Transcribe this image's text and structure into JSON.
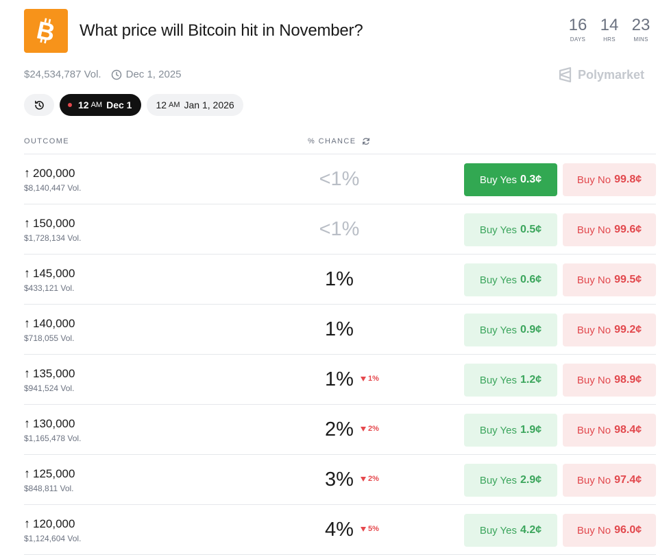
{
  "market": {
    "title": "What price will Bitcoin hit in November?",
    "volume": "$24,534,787 Vol.",
    "end_date": "Dec 1, 2025",
    "brand": "Polymarket",
    "logo_icon": "bitcoin-icon",
    "logo_color": "#f7931a"
  },
  "countdown": {
    "days": "16",
    "days_label": "DAYS",
    "hrs": "14",
    "hrs_label": "HRS",
    "mins": "23",
    "mins_label": "MINS"
  },
  "filters": {
    "history_icon": "history-icon",
    "active": {
      "time": "12",
      "suffix": "AM",
      "date": "Dec 1"
    },
    "other": {
      "time": "12",
      "suffix": "AM",
      "date": "Jan 1, 2026"
    }
  },
  "table": {
    "col_outcome": "OUTCOME",
    "col_chance": "% CHANCE",
    "rows": [
      {
        "name": "200,000",
        "vol": "$8,140,447 Vol.",
        "chance": "<1%",
        "delta": "",
        "yes": "0.3¢",
        "no": "99.8¢"
      },
      {
        "name": "150,000",
        "vol": "$1,728,134 Vol.",
        "chance": "<1%",
        "delta": "",
        "yes": "0.5¢",
        "no": "99.6¢"
      },
      {
        "name": "145,000",
        "vol": "$433,121 Vol.",
        "chance": "1%",
        "delta": "",
        "yes": "0.6¢",
        "no": "99.5¢"
      },
      {
        "name": "140,000",
        "vol": "$718,055 Vol.",
        "chance": "1%",
        "delta": "",
        "yes": "0.9¢",
        "no": "99.2¢"
      },
      {
        "name": "135,000",
        "vol": "$941,524 Vol.",
        "chance": "1%",
        "delta": "1%",
        "yes": "1.2¢",
        "no": "98.9¢"
      },
      {
        "name": "130,000",
        "vol": "$1,165,478 Vol.",
        "chance": "2%",
        "delta": "2%",
        "yes": "1.9¢",
        "no": "98.4¢"
      },
      {
        "name": "125,000",
        "vol": "$848,811 Vol.",
        "chance": "3%",
        "delta": "2%",
        "yes": "2.9¢",
        "no": "97.4¢"
      },
      {
        "name": "120,000",
        "vol": "$1,124,604 Vol.",
        "chance": "4%",
        "delta": "5%",
        "yes": "4.2¢",
        "no": "96.0¢"
      }
    ],
    "yes_label": "Buy Yes",
    "no_label": "Buy No",
    "outcome_prefix": "↑"
  },
  "colors": {
    "yes_bg": "#e5f6ea",
    "yes_text": "#3ba55c",
    "yes_solid": "#32a852",
    "no_bg": "#fbe9e9",
    "no_text": "#e2484d"
  }
}
